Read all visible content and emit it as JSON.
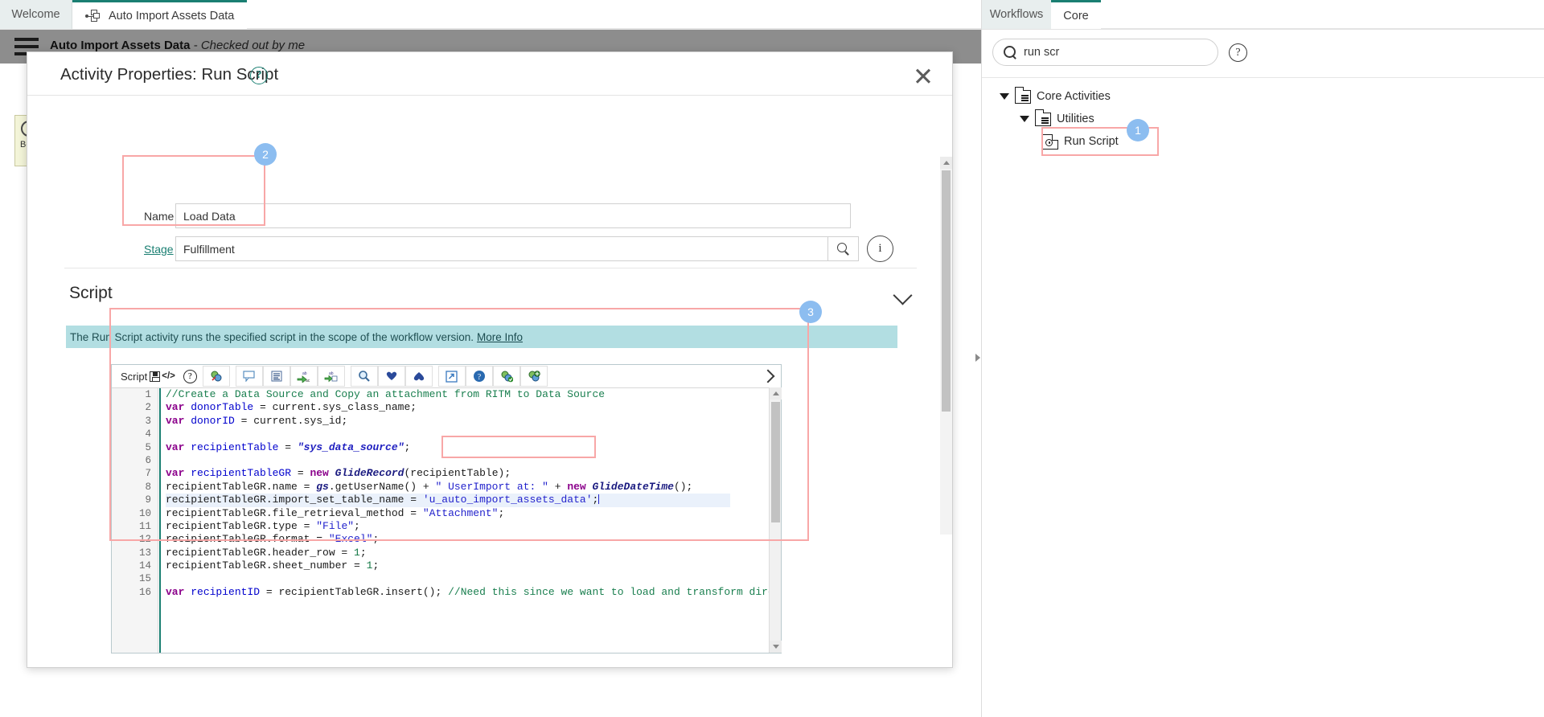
{
  "editor_tabs": [
    {
      "label": "Welcome",
      "icon": "",
      "active": false
    },
    {
      "label": "Auto Import Assets Data",
      "icon": "workflow-icon",
      "active": true
    }
  ],
  "app_header": {
    "title": "Auto Import Assets Data",
    "subtitle": "- Checked out by me",
    "menu_icon": "hamburger-icon",
    "icons": [
      "info-icon",
      "play-icon",
      "checkbox-icon",
      "help-icon"
    ]
  },
  "canvas": {
    "node_label": "Begin"
  },
  "modal": {
    "title": "Activity Properties: Run Script",
    "help_icon": "question-mark-icon",
    "close_icon": "close-icon",
    "form": {
      "name": {
        "label": "Name",
        "value": "Load Data"
      },
      "stage": {
        "label": "Stage",
        "value": "Fulfillment",
        "search_icon": "magnifier-icon",
        "info_icon": "info-icon"
      }
    },
    "script_section": {
      "heading": "Script",
      "chevron_icon": "chevron-down-icon",
      "banner_text": "The Run Script activity runs the specified script in the scope of the workflow version.",
      "banner_link": "More Info"
    },
    "editor": {
      "toolbar_label": "Script",
      "save_icon": "save-icon",
      "code_icon": "code-tag-icon",
      "help_icon": "question-mark-icon",
      "expand_icon": "chevron-right-icon",
      "buttons": [
        {
          "name": "format-code-icon",
          "glyph": "◔"
        },
        {
          "name": "comment-icon",
          "glyph": "▭"
        },
        {
          "name": "indent-icon",
          "glyph": "≡"
        },
        {
          "name": "replace-icon",
          "glyph": "⇒"
        },
        {
          "name": "replace-all-icon",
          "glyph": "⇒"
        },
        {
          "name": "find-icon",
          "glyph": "⚲"
        },
        {
          "name": "find-next-icon",
          "glyph": "♥"
        },
        {
          "name": "find-previous-icon",
          "glyph": "▲"
        },
        {
          "name": "open-in-new-window-icon",
          "glyph": "↗"
        },
        {
          "name": "help-bubble-icon",
          "glyph": "?"
        },
        {
          "name": "syntax-check-icon",
          "glyph": "✔"
        },
        {
          "name": "debug-icon",
          "glyph": "⚙"
        }
      ],
      "code_lines": [
        {
          "n": 1,
          "active": false,
          "tokens": [
            {
              "t": "cmt",
              "v": "//Create a Data Source and Copy an attachment from RITM to Data Source"
            }
          ]
        },
        {
          "n": 2,
          "active": false,
          "tokens": [
            {
              "t": "kw",
              "v": "var"
            },
            {
              "t": "p",
              "v": " "
            },
            {
              "t": "vr",
              "v": "donorTable"
            },
            {
              "t": "p",
              "v": " = current.sys_class_name;"
            }
          ]
        },
        {
          "n": 3,
          "active": false,
          "tokens": [
            {
              "t": "kw",
              "v": "var"
            },
            {
              "t": "p",
              "v": " "
            },
            {
              "t": "vr",
              "v": "donorID"
            },
            {
              "t": "p",
              "v": " = current.sys_id;"
            }
          ]
        },
        {
          "n": 4,
          "active": false,
          "tokens": [
            {
              "t": "p",
              "v": ""
            }
          ]
        },
        {
          "n": 5,
          "active": false,
          "tokens": [
            {
              "t": "kw",
              "v": "var"
            },
            {
              "t": "p",
              "v": " "
            },
            {
              "t": "vr",
              "v": "recipientTable"
            },
            {
              "t": "p",
              "v": " = "
            },
            {
              "t": "str",
              "v": "\"sys_data_source\""
            },
            {
              "t": "p",
              "v": ";"
            }
          ]
        },
        {
          "n": 6,
          "active": false,
          "tokens": [
            {
              "t": "p",
              "v": ""
            }
          ]
        },
        {
          "n": 7,
          "active": false,
          "tokens": [
            {
              "t": "kw",
              "v": "var"
            },
            {
              "t": "p",
              "v": " "
            },
            {
              "t": "vr",
              "v": "recipientTableGR"
            },
            {
              "t": "p",
              "v": " = "
            },
            {
              "t": "kw",
              "v": "new"
            },
            {
              "t": "p",
              "v": " "
            },
            {
              "t": "cls",
              "v": "GlideRecord"
            },
            {
              "t": "p",
              "v": "(recipientTable);"
            }
          ]
        },
        {
          "n": 8,
          "active": false,
          "tokens": [
            {
              "t": "p",
              "v": "recipientTableGR.name = "
            },
            {
              "t": "cls",
              "v": "gs"
            },
            {
              "t": "p",
              "v": ".getUserName() + "
            },
            {
              "t": "str2",
              "v": "\" UserImport at: \""
            },
            {
              "t": "p",
              "v": " + "
            },
            {
              "t": "kw",
              "v": "new"
            },
            {
              "t": "p",
              "v": " "
            },
            {
              "t": "cls",
              "v": "GlideDateTime"
            },
            {
              "t": "p",
              "v": "();"
            }
          ]
        },
        {
          "n": 9,
          "active": true,
          "tokens": [
            {
              "t": "p",
              "v": "recipientTableGR.import_set_table_name = "
            },
            {
              "t": "str2",
              "v": "'u_auto_import_assets_data'"
            },
            {
              "t": "p",
              "v": ";"
            }
          ]
        },
        {
          "n": 10,
          "active": false,
          "tokens": [
            {
              "t": "p",
              "v": "recipientTableGR.file_retrieval_method = "
            },
            {
              "t": "str2",
              "v": "\"Attachment\""
            },
            {
              "t": "p",
              "v": ";"
            }
          ]
        },
        {
          "n": 11,
          "active": false,
          "tokens": [
            {
              "t": "p",
              "v": "recipientTableGR.type = "
            },
            {
              "t": "str2",
              "v": "\"File\""
            },
            {
              "t": "p",
              "v": ";"
            }
          ]
        },
        {
          "n": 12,
          "active": false,
          "tokens": [
            {
              "t": "p",
              "v": "recipientTableGR.format = "
            },
            {
              "t": "str2",
              "v": "\"Excel\""
            },
            {
              "t": "p",
              "v": ";"
            }
          ]
        },
        {
          "n": 13,
          "active": false,
          "tokens": [
            {
              "t": "p",
              "v": "recipientTableGR.header_row = "
            },
            {
              "t": "num",
              "v": "1"
            },
            {
              "t": "p",
              "v": ";"
            }
          ]
        },
        {
          "n": 14,
          "active": false,
          "tokens": [
            {
              "t": "p",
              "v": "recipientTableGR.sheet_number = "
            },
            {
              "t": "num",
              "v": "1"
            },
            {
              "t": "p",
              "v": ";"
            }
          ]
        },
        {
          "n": 15,
          "active": false,
          "tokens": [
            {
              "t": "p",
              "v": ""
            }
          ]
        },
        {
          "n": 16,
          "active": false,
          "tokens": [
            {
              "t": "kw",
              "v": "var"
            },
            {
              "t": "p",
              "v": " "
            },
            {
              "t": "vr",
              "v": "recipientID"
            },
            {
              "t": "p",
              "v": " = recipientTableGR.insert(); "
            },
            {
              "t": "cmt",
              "v": "//Need this since we want to load and transform directly"
            }
          ]
        }
      ]
    }
  },
  "palette": {
    "tabs": [
      {
        "label": "Workflows",
        "active": false
      },
      {
        "label": "Core",
        "active": true
      }
    ],
    "search": {
      "value": "run scr",
      "placeholder": "",
      "icon": "search-icon"
    },
    "help_icon": "question-mark-icon",
    "tree": [
      {
        "label": "Core Activities",
        "icon": "folder-icon",
        "caret": "caret-down-icon",
        "depth": 0
      },
      {
        "label": "Utilities",
        "icon": "folder-icon",
        "caret": "caret-down-icon",
        "depth": 1
      },
      {
        "label": "Run Script",
        "icon": "script-icon",
        "caret": "",
        "depth": 2
      }
    ]
  },
  "annotations": [
    {
      "number": "1",
      "target": "run-script-tree-item"
    },
    {
      "number": "2",
      "target": "name-stage-form-fields"
    },
    {
      "number": "3",
      "target": "script-editor"
    }
  ],
  "colors": {
    "accent_teal": "#1a7f72",
    "annotation_red": "#f8a7a7",
    "badge_blue": "#8cbdf0",
    "banner_blue": "#b2dee2",
    "header_grey": "#8d8d8d"
  }
}
